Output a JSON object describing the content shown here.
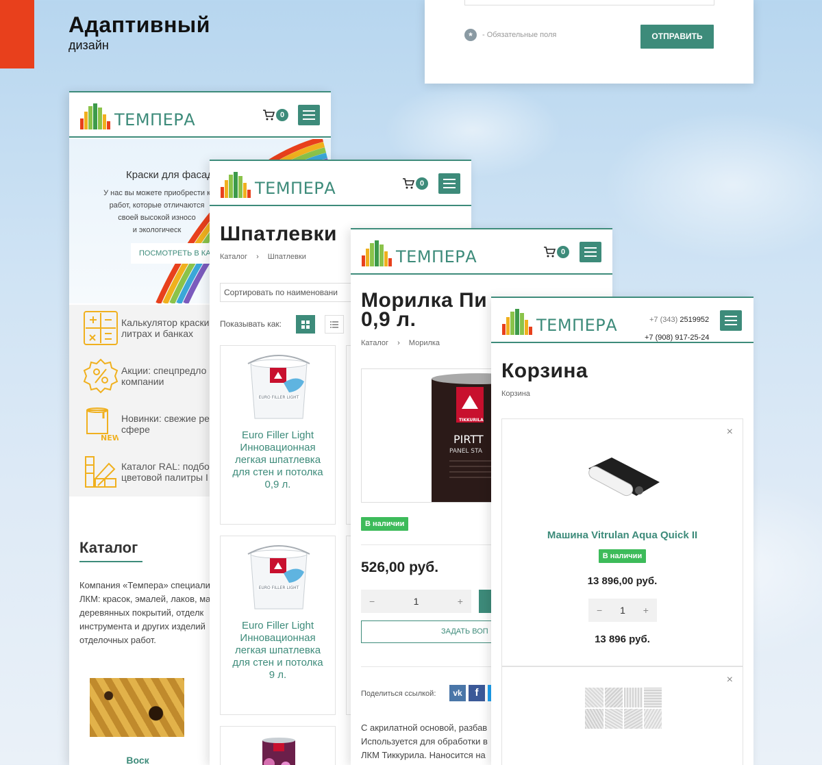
{
  "header": {
    "title": "Адаптивный",
    "subtitle": "дизайн"
  },
  "form": {
    "required_note": "- Обязательные поля",
    "required_star": "*",
    "submit_label": "ОТПРАВИТЬ"
  },
  "brand": {
    "name": "ТЕМПЕРА",
    "accent": "#3d8b7a",
    "orange": "#e8401c",
    "stock_green": "#3dbb5a",
    "icon_color": "#f0b01e"
  },
  "cart_count": "0",
  "home": {
    "hero_title": "Краски для фасад",
    "hero_text": [
      "У нас вы можете приобрести к",
      "работ, которые отличаются",
      "своей высокой износо",
      "и экологическ"
    ],
    "hero_button": "ПОСМОТРЕТЬ В КА",
    "features": [
      {
        "icon": "calculator-icon",
        "text": [
          "Калькулятор краски",
          "литрах и банках"
        ]
      },
      {
        "icon": "percent-badge-icon",
        "text": [
          "Акции: спецпредло",
          "компании"
        ]
      },
      {
        "icon": "paint-bucket-new-icon",
        "text": [
          "Новинки: свежие ре",
          "сфере"
        ]
      },
      {
        "icon": "color-palette-icon",
        "text": [
          "Каталог RAL: подбо",
          "цветовой палитры I"
        ]
      }
    ],
    "catalog_title": "Каталог",
    "catalog_text": [
      "Компания «Темпера» специали",
      "ЛКМ: красок, эмалей, лаков, ма",
      "деревянных покрытий, отделк",
      "инструмента и других изделий",
      "отделочных работ."
    ],
    "catalog_item": "Воск"
  },
  "putty": {
    "title": "Шпатлевки",
    "crumb_root": "Каталог",
    "crumb_sep": "›",
    "crumb_current": "Шпатлевки",
    "sort_value": "Сортировать по наименовани",
    "view_label": "Показывать как:",
    "products": [
      {
        "name": "Euro Filler Light Инновационная легкая шпатлевка для стен и потолка 0,9 л.",
        "lines": [
          "Euro Filler Light",
          "Инновационная",
          "легкая шпатлевка",
          "для стен и потолка",
          "0,9 л."
        ]
      },
      {
        "name": "Euro Filler Light Инновационная легкая шпатлевка для стен и потолка 9 л.",
        "lines": [
          "Euro Filler Light",
          "Инновационная",
          "легкая шпатлевка",
          "для стен и потолка",
          "9 л."
        ]
      }
    ],
    "bucket_label": "EURO FILLER LIGHT"
  },
  "stain": {
    "title_line1": "Морилка Пи",
    "title_line2": "0,9 л.",
    "crumb_root": "Каталог",
    "crumb_sep": "›",
    "crumb_current": "Морилка",
    "can_brand": "TIKKURILA",
    "can_name": "PIRTT",
    "can_sub": "PANEL STA",
    "stock": "В наличии",
    "price": "526,00 руб.",
    "qty": "1",
    "ask_button": "ЗАДАТЬ ВОП",
    "share_label": "Поделиться ссылкой:",
    "description": [
      "С акрилатной основой, разбав",
      "Используется для обработки в",
      "ЛКМ Тиккурила.  Наносится на"
    ]
  },
  "cart": {
    "phone1_prefix": "+7 (343)",
    "phone1_number": "2519952",
    "phone2": "+7 (908) 917-25-24",
    "title": "Корзина",
    "crumb": "Корзина",
    "item_name": "Машина Vitrulan Aqua Quick II",
    "stock": "В наличии",
    "unit_price": "13 896,00 руб.",
    "qty": "1",
    "total": "13 896 руб."
  }
}
